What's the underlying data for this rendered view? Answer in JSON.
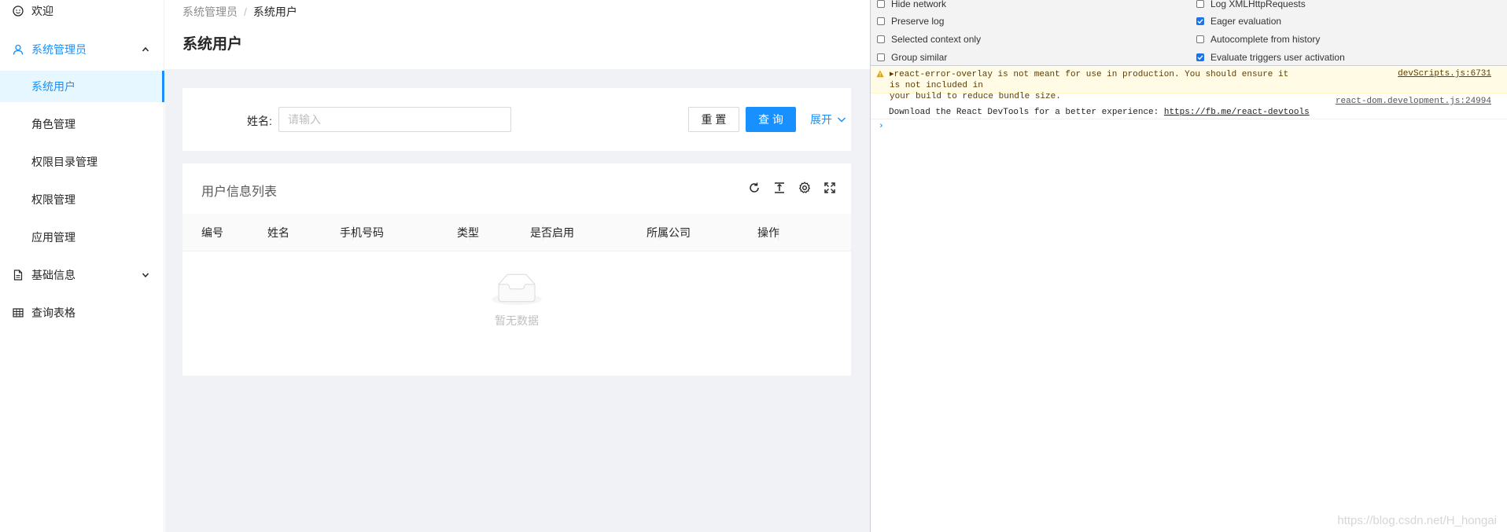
{
  "sidebar": {
    "welcome": "欢迎",
    "system_admin": "系统管理员",
    "sub_items": [
      "系统用户",
      "角色管理",
      "权限目录管理",
      "权限管理",
      "应用管理"
    ],
    "basic_info": "基础信息",
    "query_table": "查询表格"
  },
  "header": {
    "breadcrumb_parent": "系统管理员",
    "breadcrumb_sep": "/",
    "breadcrumb_current": "系统用户",
    "title": "系统用户"
  },
  "search": {
    "name_label": "姓名:",
    "name_placeholder": "请输入",
    "reset_label": "重 置",
    "query_label": "查 询",
    "expand_label": "展开"
  },
  "table": {
    "title": "用户信息列表",
    "columns": [
      "编号",
      "姓名",
      "手机号码",
      "类型",
      "是否启用",
      "所属公司",
      "操作"
    ],
    "empty_text": "暂无数据"
  },
  "devtools": {
    "options": [
      {
        "label": "Hide network",
        "checked": false
      },
      {
        "label": "Log XMLHttpRequests",
        "checked": false
      },
      {
        "label": "Preserve log",
        "checked": false
      },
      {
        "label": "Eager evaluation",
        "checked": true
      },
      {
        "label": "Selected context only",
        "checked": false
      },
      {
        "label": "Autocomplete from history",
        "checked": false
      },
      {
        "label": "Group similar",
        "checked": false
      },
      {
        "label": "Evaluate triggers user activation",
        "checked": true
      }
    ],
    "warning": {
      "text_line1": "▸react-error-overlay is not meant for use in production. You should ensure it is not included in",
      "text_line2": "your build to reduce bundle size.",
      "source": "devScripts.js:6731"
    },
    "log": {
      "source": "react-dom.development.js:24994",
      "text": "Download the React DevTools for a better experience: ",
      "link": "https://fb.me/react-devtools"
    },
    "prompt_symbol": "›"
  },
  "watermark": "https://blog.csdn.net/H_hongai",
  "colors": {
    "accent": "#1890ff",
    "selected_bg": "#e6f7ff",
    "page_bg": "#f0f2f5"
  }
}
